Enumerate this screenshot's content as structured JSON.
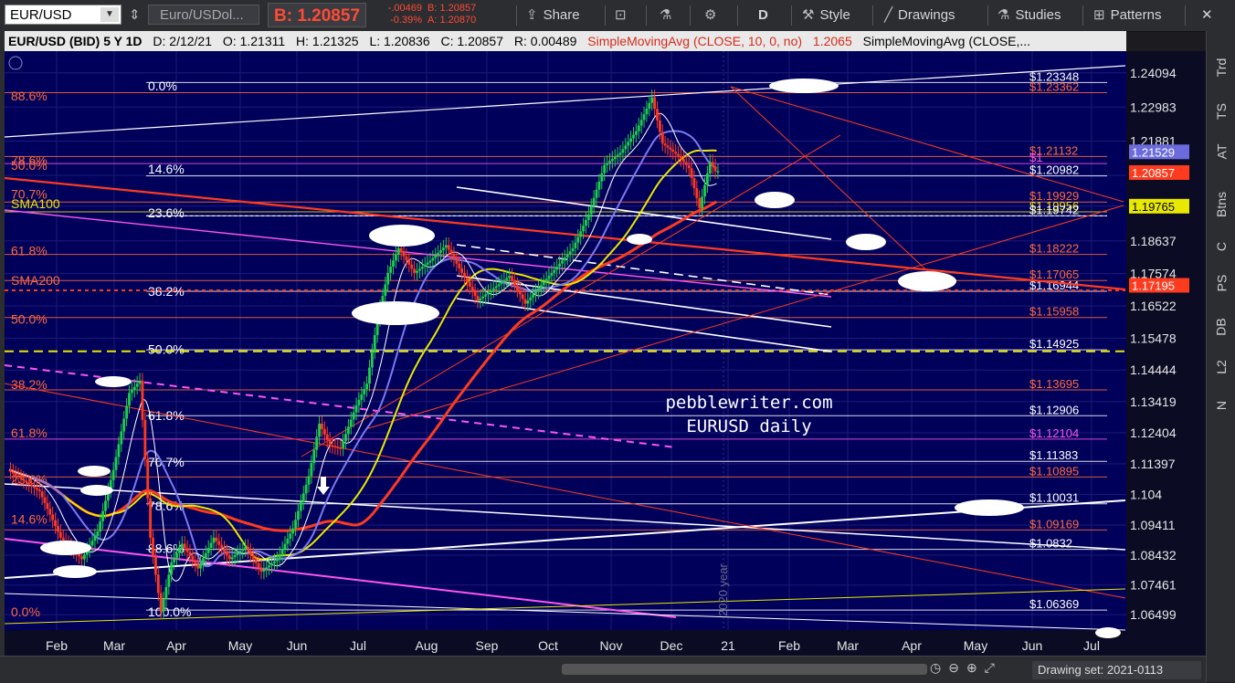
{
  "toolbar": {
    "symbol": "EUR/USD",
    "description": "Euro/USDol...",
    "bid": "B: 1.20857",
    "change": "-.00469",
    "change_pct": "-0.39%",
    "bid_small": "B: 1.20857",
    "ask_small": "A: 1.20870",
    "share": "Share",
    "period": "D",
    "style": "Style",
    "drawings": "Drawings",
    "studies": "Studies",
    "patterns": "Patterns"
  },
  "header": {
    "symbol": "EUR/USD (BID) 5 Y 1D",
    "date": "D: 2/12/21",
    "open": "O: 1.21311",
    "high": "H: 1.21325",
    "low": "L: 1.20836",
    "close": "C: 1.20857",
    "range": "R: 0.00489",
    "study1": "SimpleMovingAvg (CLOSE, 10, 0, no)",
    "study1_val": "1.2065",
    "study2": "SimpleMovingAvg (CLOSE,..."
  },
  "right_tabs": [
    "Trd",
    "TS",
    "AT",
    "Btns",
    "C",
    "PS",
    "DB",
    "L2",
    "N"
  ],
  "bottom": {
    "drawing_set": "Drawing set: 2021-0113"
  },
  "colors": {
    "background": "#00005a",
    "price": "#ff3b1f",
    "sma200": "#ff3b1f",
    "sma100": "#e8e800",
    "sma50": "#7a7af0",
    "sma20": "#ffffff",
    "fib_left": "#ff6a3c",
    "fib_mid": "#ffffff",
    "magenta": "#ff55ee"
  },
  "chart_data": {
    "type": "candlestick",
    "title": "EUR/USD (BID) 5 Y 1D",
    "y_ticks": [
      1.24094,
      1.22983,
      1.21881,
      1.20768,
      1.19765,
      1.18637,
      1.17574,
      1.16522,
      1.15478,
      1.14444,
      1.13419,
      1.12404,
      1.11397,
      1.104,
      1.09411,
      1.08432,
      1.07461,
      1.06499
    ],
    "ylim": [
      1.06,
      1.248
    ],
    "x_ticks": [
      "Feb",
      "Mar",
      "Apr",
      "May",
      "Jun",
      "Jul",
      "Aug",
      "Sep",
      "Oct",
      "Nov",
      "Dec",
      "21",
      "Feb",
      "Mar",
      "Apr",
      "May",
      "Jun",
      "Jul"
    ],
    "price_tags": [
      {
        "label": "1.21529",
        "value": 1.21529,
        "color": "#6b6bde"
      },
      {
        "label": "1.20857",
        "value": 1.20857,
        "color": "#ff3b1f"
      },
      {
        "label": "1.19765",
        "value": 1.19765,
        "color": "#e8e800"
      },
      {
        "label": "1.17195",
        "value": 1.17195,
        "color": "#ff3b1f"
      }
    ],
    "fib_left_labels": [
      {
        "label": "88.6%",
        "value": 1.2334
      },
      {
        "label": "78.6%",
        "value": 1.2125
      },
      {
        "label": "50.0%",
        "value": 1.2109
      },
      {
        "label": "70.7%",
        "value": 1.2016
      },
      {
        "label": "SMA100",
        "value": 1.1985
      },
      {
        "label": "61.8%",
        "value": 1.1832
      },
      {
        "label": "SMA200",
        "value": 1.1735
      },
      {
        "label": "50.0%",
        "value": 1.161
      },
      {
        "label": "38.2%",
        "value": 1.1398
      },
      {
        "label": "61.8%",
        "value": 1.124
      },
      {
        "label": "23.6%",
        "value": 1.109
      },
      {
        "label": "14.6%",
        "value": 1.096
      },
      {
        "label": "0.0%",
        "value": 1.066
      }
    ],
    "fib_mid_labels": [
      {
        "label": "0.0%",
        "value": 1.2368
      },
      {
        "label": "14.6%",
        "value": 1.2098
      },
      {
        "label": "23.6%",
        "value": 1.1955
      },
      {
        "label": "38.2%",
        "value": 1.17
      },
      {
        "label": "50.0%",
        "value": 1.1512
      },
      {
        "label": "61.8%",
        "value": 1.1297
      },
      {
        "label": "70.7%",
        "value": 1.1146
      },
      {
        "label": "78.6%",
        "value": 1.1003
      },
      {
        "label": "88.6%",
        "value": 1.0865
      },
      {
        "label": "100.0%",
        "value": 1.066
      }
    ],
    "right_levels": [
      {
        "label": "$1.23348",
        "value": 1.2378,
        "color": "#ffffff"
      },
      {
        "label": "$1.23362",
        "value": 1.2345,
        "color": "#ff6a3c"
      },
      {
        "label": "$1.21132",
        "value": 1.2138,
        "color": "#ff6a3c"
      },
      {
        "label": "$1",
        "value": 1.2115,
        "color": "#ff55ee"
      },
      {
        "label": "$1.20982",
        "value": 1.2075,
        "color": "#ffffff"
      },
      {
        "label": "$1.19929",
        "value": 1.199,
        "color": "#ff6a3c"
      },
      {
        "label": "$1.19956",
        "value": 1.1958,
        "color": "#e8e800"
      },
      {
        "label": "$1.19742",
        "value": 1.1945,
        "color": "#ffffff"
      },
      {
        "label": "$1.18222",
        "value": 1.182,
        "color": "#ff6a3c"
      },
      {
        "label": "$1.17065",
        "value": 1.1735,
        "color": "#ff6a3c"
      },
      {
        "label": "$1.16944",
        "value": 1.17,
        "color": "#ffffff"
      },
      {
        "label": "$1.15958",
        "value": 1.1615,
        "color": "#ff6a3c"
      },
      {
        "label": "$1.14925",
        "value": 1.151,
        "color": "#ffffff"
      },
      {
        "label": "$1.13695",
        "value": 1.138,
        "color": "#ff6a3c"
      },
      {
        "label": "$1.12906",
        "value": 1.1296,
        "color": "#ffffff"
      },
      {
        "label": "$1.12104",
        "value": 1.122,
        "color": "#ff55ee"
      },
      {
        "label": "$1.11383",
        "value": 1.1148,
        "color": "#ffffff"
      },
      {
        "label": "$1.10895",
        "value": 1.1097,
        "color": "#ff6a3c"
      },
      {
        "label": "$1.10031",
        "value": 1.101,
        "color": "#ffffff"
      },
      {
        "label": "$1.09169",
        "value": 1.0925,
        "color": "#ff6a3c"
      },
      {
        "label": "$1.0832",
        "value": 1.0862,
        "color": "#ffffff"
      },
      {
        "label": "$1.06369",
        "value": 1.0665,
        "color": "#ffffff"
      }
    ],
    "annotations": [
      "pebblewriter.com",
      "EURUSD daily",
      "2020 year"
    ],
    "ohlc_last": {
      "date": "2/12/21",
      "open": 1.21311,
      "high": 1.21325,
      "low": 1.20836,
      "close": 1.20857
    },
    "price_path": [
      [
        0,
        1.112
      ],
      [
        6,
        1.105
      ],
      [
        10,
        1.09
      ],
      [
        14,
        1.083
      ],
      [
        17,
        1.092
      ],
      [
        20,
        1.112
      ],
      [
        23,
        1.137
      ],
      [
        25,
        1.141
      ],
      [
        27,
        1.09
      ],
      [
        29,
        1.066
      ],
      [
        31,
        1.082
      ],
      [
        33,
        1.088
      ],
      [
        36,
        1.08
      ],
      [
        39,
        1.09
      ],
      [
        42,
        1.083
      ],
      [
        45,
        1.087
      ],
      [
        48,
        1.079
      ],
      [
        51,
        1.083
      ],
      [
        54,
        1.093
      ],
      [
        57,
        1.11
      ],
      [
        59,
        1.127
      ],
      [
        61,
        1.12
      ],
      [
        63,
        1.119
      ],
      [
        66,
        1.133
      ],
      [
        68,
        1.14
      ],
      [
        70,
        1.161
      ],
      [
        72,
        1.176
      ],
      [
        74,
        1.184
      ],
      [
        77,
        1.176
      ],
      [
        80,
        1.18
      ],
      [
        83,
        1.185
      ],
      [
        86,
        1.176
      ],
      [
        89,
        1.167
      ],
      [
        92,
        1.171
      ],
      [
        95,
        1.175
      ],
      [
        98,
        1.166
      ],
      [
        101,
        1.172
      ],
      [
        104,
        1.178
      ],
      [
        107,
        1.184
      ],
      [
        110,
        1.195
      ],
      [
        113,
        1.211
      ],
      [
        116,
        1.215
      ],
      [
        119,
        1.222
      ],
      [
        122,
        1.233
      ],
      [
        124,
        1.218
      ],
      [
        127,
        1.214
      ],
      [
        129,
        1.21
      ],
      [
        131,
        1.197
      ],
      [
        133,
        1.212
      ],
      [
        134,
        1.209
      ]
    ]
  }
}
